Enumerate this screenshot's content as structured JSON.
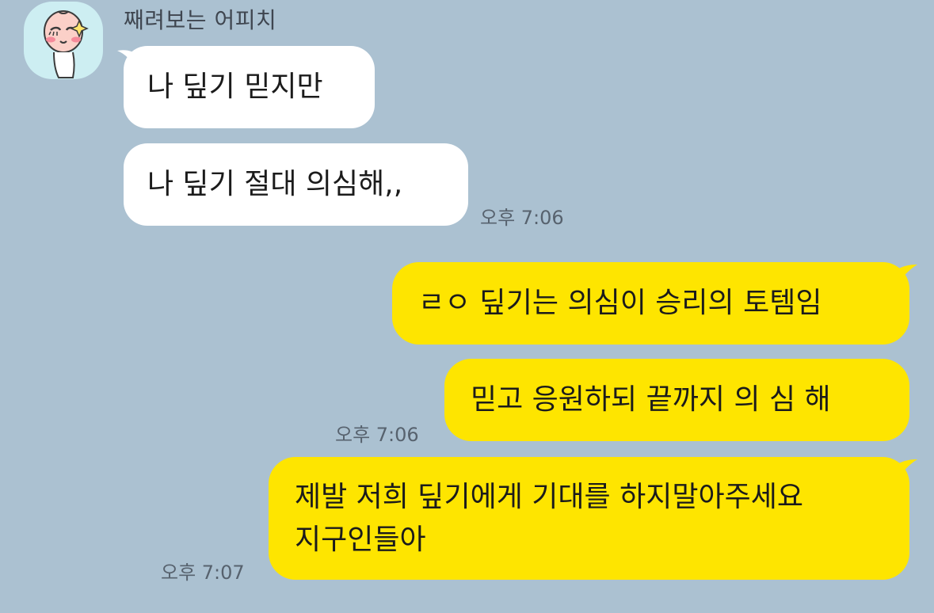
{
  "chat": {
    "sender": {
      "name": "째려보는 어피치",
      "avatar_icon": "apeach-profile-icon"
    },
    "messages": [
      {
        "id": "m1",
        "direction": "incoming",
        "text": "나 딮기 믿지만",
        "time": ""
      },
      {
        "id": "m2",
        "direction": "incoming",
        "text": "나 딮기 절대 의심해,,",
        "time": "오후 7:06"
      },
      {
        "id": "m3",
        "direction": "outgoing",
        "text": "ㄹㅇ 딮기는 의심이 승리의 토템임",
        "time": ""
      },
      {
        "id": "m4",
        "direction": "outgoing",
        "text": "믿고 응원하되 끝까지 의 심 해",
        "time": "오후 7:06"
      },
      {
        "id": "m5",
        "direction": "outgoing",
        "lines": [
          "제발 저희 딮기에게 기대를 하지말아주세요",
          "지구인들아"
        ],
        "time": "오후 7:07"
      }
    ]
  },
  "colors": {
    "background": "#abc1d1",
    "incoming_bubble": "#ffffff",
    "outgoing_bubble": "#fee500"
  }
}
